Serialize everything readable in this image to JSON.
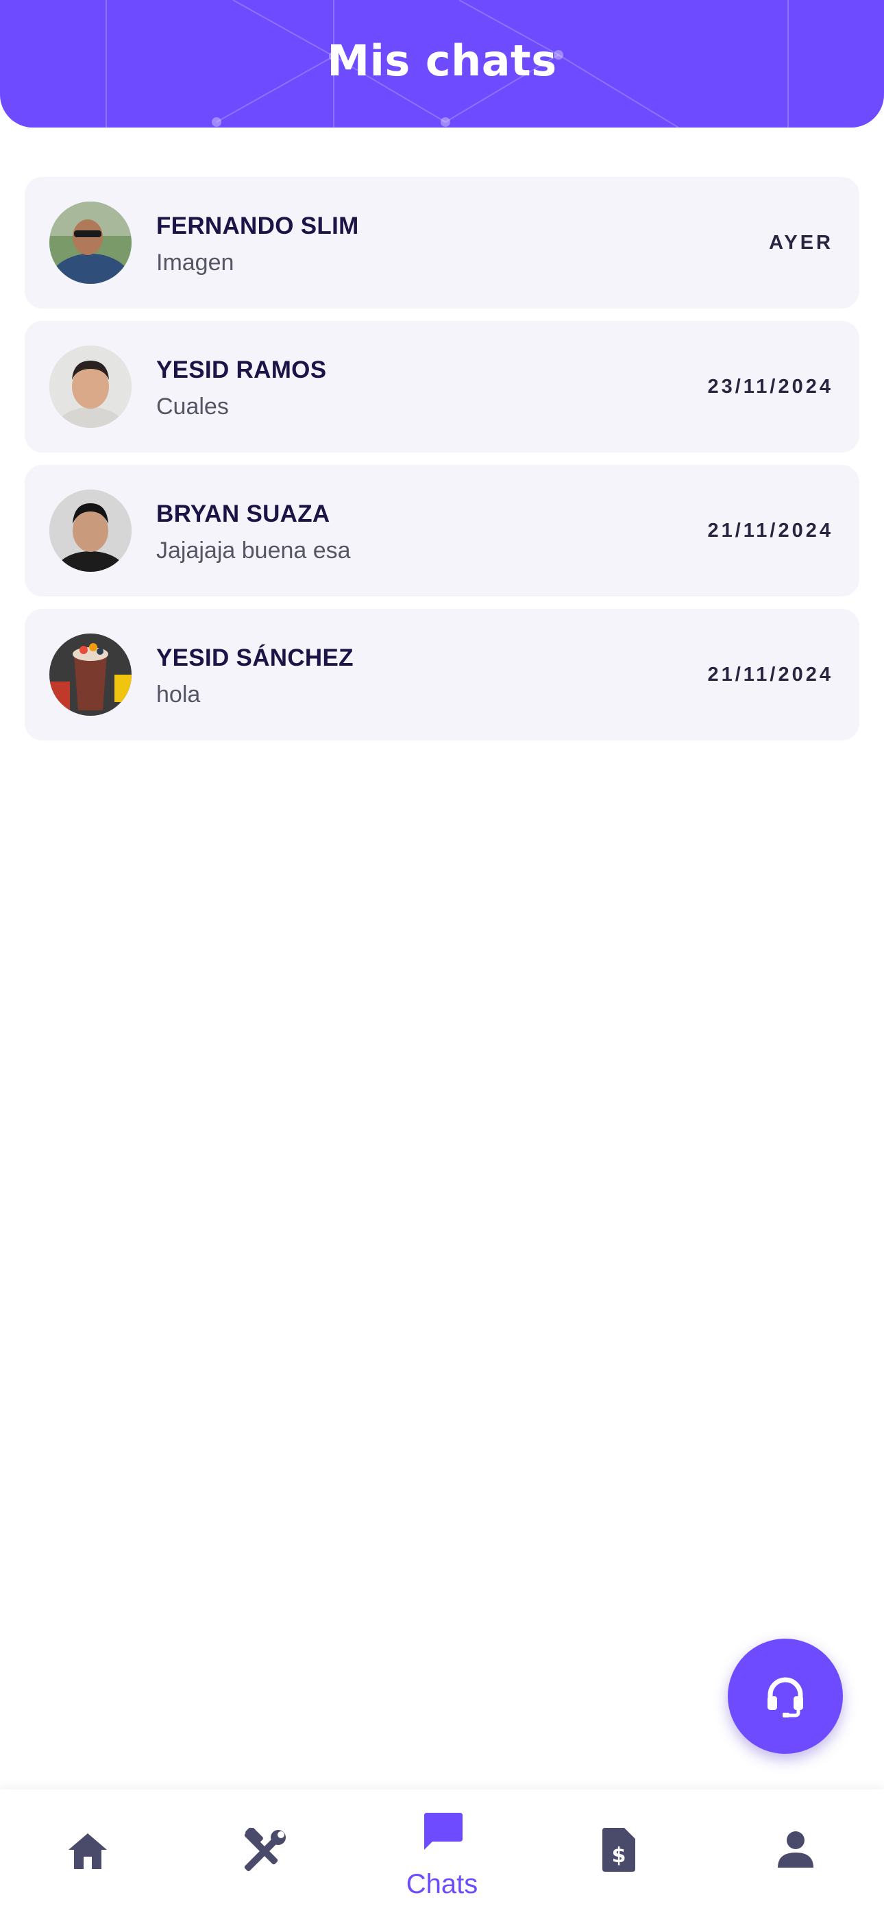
{
  "header": {
    "title": "Mis chats"
  },
  "chats": [
    {
      "name": "FERNANDO SLIM",
      "preview": "Imagen",
      "date": "AYER"
    },
    {
      "name": "YESID RAMOS",
      "preview": "Cuales",
      "date": "23/11/2024"
    },
    {
      "name": "BRYAN SUAZA",
      "preview": "Jajajaja buena esa",
      "date": "21/11/2024"
    },
    {
      "name": "YESID SÁNCHEZ",
      "preview": "hola",
      "date": "21/11/2024"
    }
  ],
  "fab": {
    "icon": "headset-icon"
  },
  "nav": {
    "items": [
      {
        "icon": "home-icon"
      },
      {
        "icon": "tools-icon"
      },
      {
        "icon": "chat-icon",
        "label": "Chats",
        "active": true
      },
      {
        "icon": "invoice-icon"
      },
      {
        "icon": "user-icon"
      }
    ]
  },
  "colors": {
    "primary": "#6e4bff",
    "card_bg": "#f4f4fa",
    "name_text": "#1c1346",
    "nav_icon": "#4a4a6a"
  }
}
